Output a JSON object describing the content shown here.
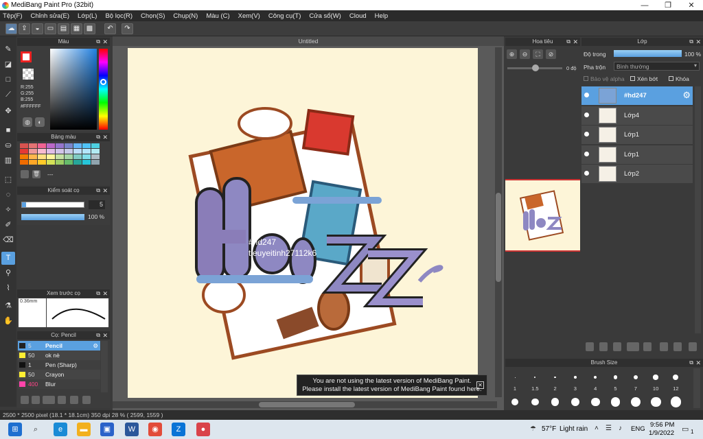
{
  "window": {
    "title": "MediBang Paint Pro (32bit)",
    "controls": [
      "—",
      "❐",
      "✕"
    ]
  },
  "menu": [
    "Tệp(F)",
    "Chỉnh sửa(E)",
    "Lớp(L)",
    "Bộ lọc(R)",
    "Chọn(S)",
    "Chụp(N)",
    "Màu (C)",
    "Xem(V)",
    "Công cụ(T)",
    "Cửa sổ(W)",
    "Cloud",
    "Help"
  ],
  "color_panel": {
    "title": "Màu",
    "r": "R:255",
    "g": "G:255",
    "b": "B:255",
    "hex": "#FFFFFF"
  },
  "palette_panel": {
    "title": "Bảng màu",
    "more": "---",
    "colors": [
      "#d9534f",
      "#e57373",
      "#f06292",
      "#ba68c8",
      "#9575cd",
      "#7986cb",
      "#64b5f6",
      "#4fc3f7",
      "#4dd0e1",
      "#e53935",
      "#ef9a9a",
      "#f8bbd0",
      "#e1bee7",
      "#d1c4e9",
      "#c5cae9",
      "#bbdefb",
      "#b3e5fc",
      "#b2ebf2",
      "#f57c00",
      "#ffb74d",
      "#ffe082",
      "#fff59d",
      "#c5e1a5",
      "#a5d6a7",
      "#80cbc4",
      "#80deea",
      "#b0bec5",
      "#ef6c00",
      "#ffa726",
      "#ffca28",
      "#d4e157",
      "#9ccc65",
      "#66bb6a",
      "#26a69a",
      "#26c6da",
      "#90a4ae"
    ]
  },
  "brush_control": {
    "title": "Kiểm soát cọ",
    "size": "5",
    "opacity": "100 %"
  },
  "brush_preview": {
    "title": "Xem trước cọ",
    "size_label": "0.36mm"
  },
  "brush_list": {
    "title": "Cọ: Pencil",
    "items": [
      {
        "size": "5",
        "name": "Pencil",
        "color": "#222"
      },
      {
        "size": "50",
        "name": "ok nè",
        "color": "#ffee33"
      },
      {
        "size": "1",
        "name": "Pen (Sharp)",
        "color": "#111"
      },
      {
        "size": "50",
        "name": "Crayon",
        "color": "#ffee33"
      },
      {
        "size": "400",
        "name": "Blur",
        "color": "#f4a"
      }
    ]
  },
  "canvas": {
    "tab": "Untitled",
    "text_line1": "#hd247",
    "text_line2": "tieuyeitinh27112k6"
  },
  "notice": {
    "line1": "You are not using the latest version of MediBang Paint.",
    "line2": "Please install the latest version of MediBang Paint found here.",
    "close": "✕"
  },
  "navigator": {
    "title": "Hoa tiêu",
    "angle": "0 độ"
  },
  "layers": {
    "title": "Lớp",
    "opacity_label": "Độ trong",
    "opacity_value": "100 %",
    "blend_label": "Pha trộn",
    "blend_value": "Bình thường",
    "protect_alpha": "Bảo vệ alpha",
    "clipping": "Xén bớt",
    "lock": "Khóa",
    "items": [
      {
        "name": "#hd247",
        "selected": true
      },
      {
        "name": "Lớp4",
        "selected": false
      },
      {
        "name": "Lớp1",
        "selected": false
      },
      {
        "name": "Lớp1",
        "selected": false
      },
      {
        "name": "Lớp2",
        "selected": false
      }
    ]
  },
  "brush_size": {
    "title": "Brush Size",
    "sizes": [
      "1",
      "1.5",
      "2",
      "3",
      "4",
      "5",
      "7",
      "10",
      "12"
    ]
  },
  "status": {
    "text": "2500 * 2500 pixel   (18.1 * 18.1cm)   350 dpi   28 %   ( 2599, 1559 )"
  },
  "taskbar": {
    "weather_temp": "57°F",
    "weather_text": "Light rain",
    "lang": "ENG",
    "time": "9:56 PM",
    "date": "1/9/2022",
    "notif_count": "1",
    "icons": [
      {
        "name": "windows-start-icon",
        "glyph": "⊞",
        "color": "#1e6fd0"
      },
      {
        "name": "search-icon",
        "glyph": "⌕",
        "color": "#333"
      },
      {
        "name": "edge-icon",
        "glyph": "e",
        "color": "#1a8bd6"
      },
      {
        "name": "file-explorer-icon",
        "glyph": "▬",
        "color": "#f2b01e"
      },
      {
        "name": "store-icon",
        "glyph": "▣",
        "color": "#2a62c9"
      },
      {
        "name": "word-icon",
        "glyph": "W",
        "color": "#2b579a"
      },
      {
        "name": "chrome-icon",
        "glyph": "◉",
        "color": "#e24c3a"
      },
      {
        "name": "zalo-icon",
        "glyph": "Z",
        "color": "#0a74d6"
      },
      {
        "name": "medibang-icon",
        "glyph": "●",
        "color": "#d9434a"
      }
    ]
  }
}
